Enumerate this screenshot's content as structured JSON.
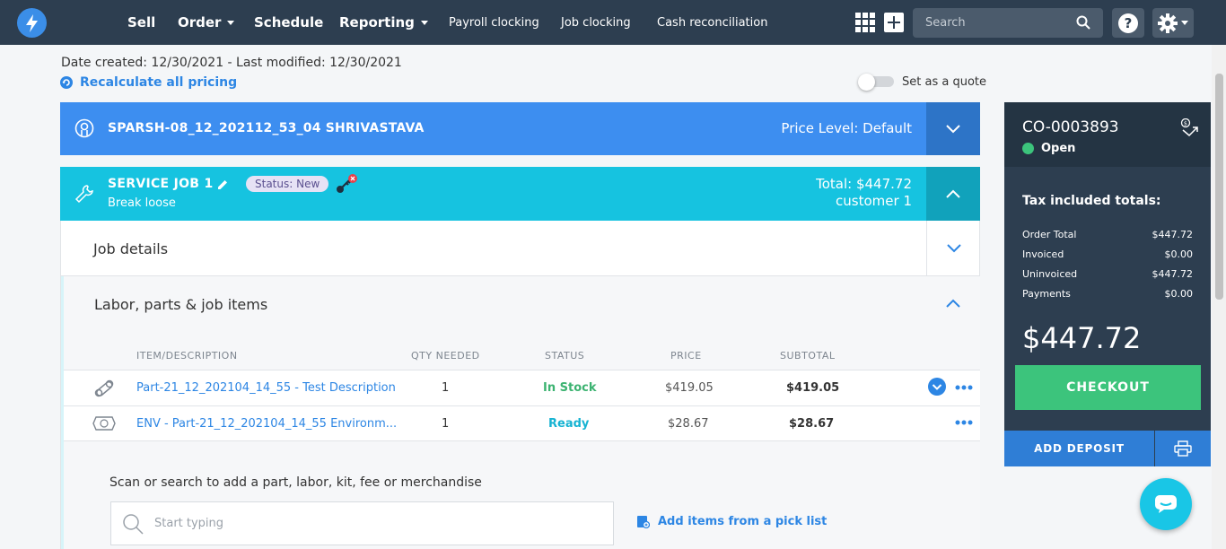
{
  "nav": {
    "items": [
      {
        "label": "Sell"
      },
      {
        "label": "Order"
      },
      {
        "label": "Schedule"
      },
      {
        "label": "Reporting"
      }
    ],
    "sub_items": [
      {
        "label": "Payroll clocking"
      },
      {
        "label": "Job clocking"
      },
      {
        "label": "Cash reconciliation"
      }
    ],
    "search_placeholder": "Search",
    "help_label": "?"
  },
  "header": {
    "date_line": "Date created: 12/30/2021 - Last modified: 12/30/2021",
    "recalculate_label": "Recalculate all pricing",
    "quote_label": "Set as a quote"
  },
  "customer": {
    "name": "SPARSH-08_12_202112_53_04 SHRIVASTAVA",
    "price_level": "Price Level: Default"
  },
  "job": {
    "title": "SERVICE JOB 1",
    "status_badge": "Status: New",
    "subtitle": "Break loose",
    "total": "Total: $447.72",
    "customer": "customer 1"
  },
  "sections": {
    "job_details": "Job details",
    "labor": "Labor, parts & job items"
  },
  "table": {
    "headers": [
      "ITEM/DESCRIPTION",
      "QTY NEEDED",
      "STATUS",
      "PRICE",
      "SUBTOTAL"
    ],
    "rows": [
      {
        "item": "Part-21_12_202104_14_55 - Test Description",
        "qty": "1",
        "status": "In Stock",
        "price": "$419.05",
        "subtotal": "$419.05"
      },
      {
        "item": "ENV - Part-21_12_202104_14_55 Environm...",
        "qty": "1",
        "status": "Ready",
        "price": "$28.67",
        "subtotal": "$28.67"
      }
    ]
  },
  "scan": {
    "label": "Scan or search to add a part, labor, kit, fee or merchandise",
    "placeholder": "Start typing",
    "picklist_label": "Add items from a pick list"
  },
  "summary": {
    "order_number": "CO-0003893",
    "status": "Open",
    "tax_title": "Tax included totals:",
    "rows": [
      {
        "label": "Order Total",
        "value": "$447.72"
      },
      {
        "label": "Invoiced",
        "value": "$0.00"
      },
      {
        "label": "Uninvoiced",
        "value": "$447.72"
      },
      {
        "label": "Payments",
        "value": "$0.00"
      }
    ],
    "big_total": "$447.72",
    "checkout_label": "CHECKOUT",
    "deposit_label": "ADD DEPOSIT"
  },
  "colors": {
    "nav": "#2d3e50",
    "customer_bar": "#3d8ef0",
    "job_bar": "#16c3e0",
    "checkout": "#3cc47c",
    "link": "#2d86e4"
  }
}
